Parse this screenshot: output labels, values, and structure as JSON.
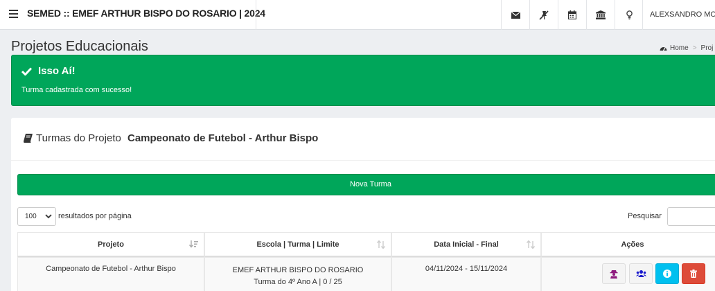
{
  "header": {
    "title": "SEMED :: EMEF ARTHUR BISPO DO ROSARIO | 2024",
    "user": "ALEXSANDRO MOT",
    "icons": [
      "envelope-icon",
      "pin-slash-icon",
      "calendar-icon",
      "bank-icon",
      "lightbulb-icon"
    ]
  },
  "page": {
    "title": "Projetos Educacionais",
    "breadcrumb": {
      "home": "Home",
      "current": "Proj"
    }
  },
  "alert": {
    "heading": "Isso Aí!",
    "message": "Turma cadastrada com sucesso!",
    "color": "#00a65a"
  },
  "box": {
    "title_prefix": "Turmas do Projeto ",
    "title_project": "Campeonato de Futebol - Arthur Bispo",
    "new_button": "Nova Turma"
  },
  "table_controls": {
    "page_length": "100",
    "page_length_label": "resultados por página",
    "search_label": "Pesquisar",
    "search_value": ""
  },
  "table": {
    "columns": [
      "Projeto",
      "Escola | Turma | Limite",
      "Data Inicial - Final",
      "Ações"
    ],
    "rows": [
      {
        "projeto": "Campeonato de Futebol - Arthur Bispo",
        "escola": "EMEF ARTHUR BISPO DO ROSARIO",
        "turma_limite": "Turma do 4º Ano A | 0 / 25",
        "datas": "04/11/2024 - 15/11/2024"
      }
    ],
    "action_colors": {
      "purple": "#f4f4f4",
      "blue": "#f4f4f4",
      "info": "#00c0ef",
      "danger": "#dd4b39"
    }
  }
}
